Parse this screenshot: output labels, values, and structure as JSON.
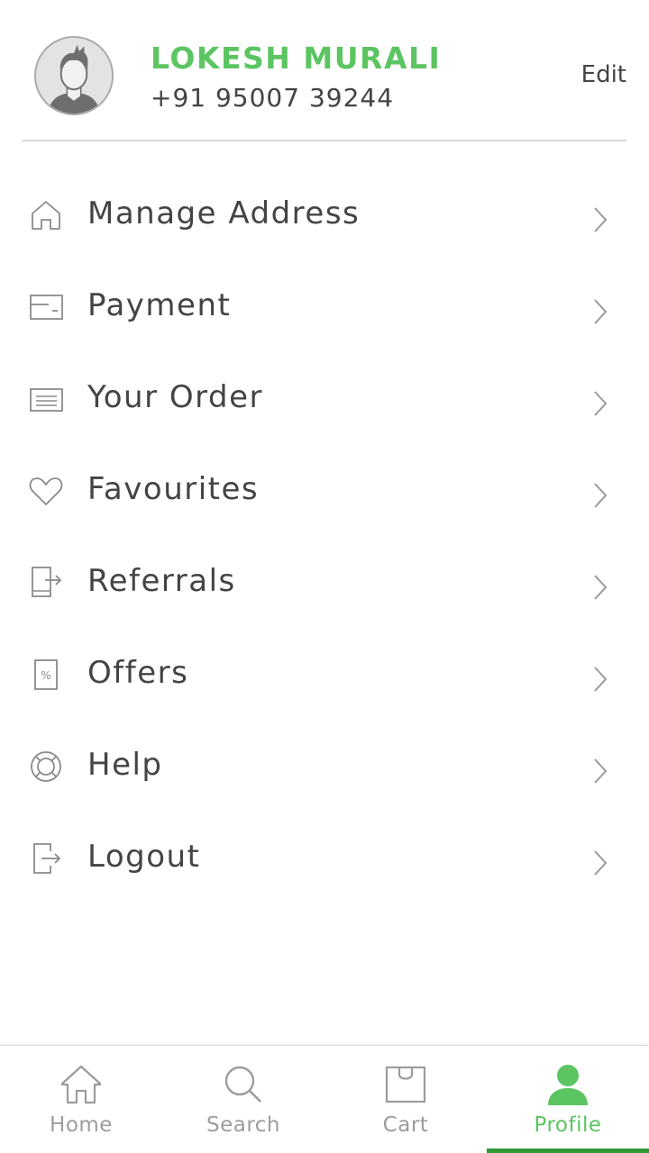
{
  "profile": {
    "name": "LOKESH MURALI",
    "phone": "+91 95007 39244",
    "edit_label": "Edit",
    "avatar_icon": "user-avatar-icon"
  },
  "menu": {
    "items": [
      {
        "label": "Manage Address",
        "icon": "home-outline-icon"
      },
      {
        "label": "Payment",
        "icon": "card-icon"
      },
      {
        "label": "Your Order",
        "icon": "order-list-icon"
      },
      {
        "label": "Favourites",
        "icon": "heart-icon"
      },
      {
        "label": "Referrals",
        "icon": "referral-share-icon"
      },
      {
        "label": "Offers",
        "icon": "percent-tag-icon"
      },
      {
        "label": "Help",
        "icon": "lifebuoy-icon"
      },
      {
        "label": "Logout",
        "icon": "logout-icon"
      }
    ],
    "chevron_icon": "chevron-right-icon"
  },
  "bottom_nav": {
    "items": [
      {
        "label": "Home",
        "icon": "home-icon",
        "active": false
      },
      {
        "label": "Search",
        "icon": "search-icon",
        "active": false
      },
      {
        "label": "Cart",
        "icon": "shopping-bag-icon",
        "active": false
      },
      {
        "label": "Profile",
        "icon": "profile-icon",
        "active": true
      }
    ]
  },
  "colors": {
    "accent": "#5cc562",
    "active_indicator": "#2e9b36",
    "text": "#444444",
    "inactive": "#9c9c9c"
  }
}
